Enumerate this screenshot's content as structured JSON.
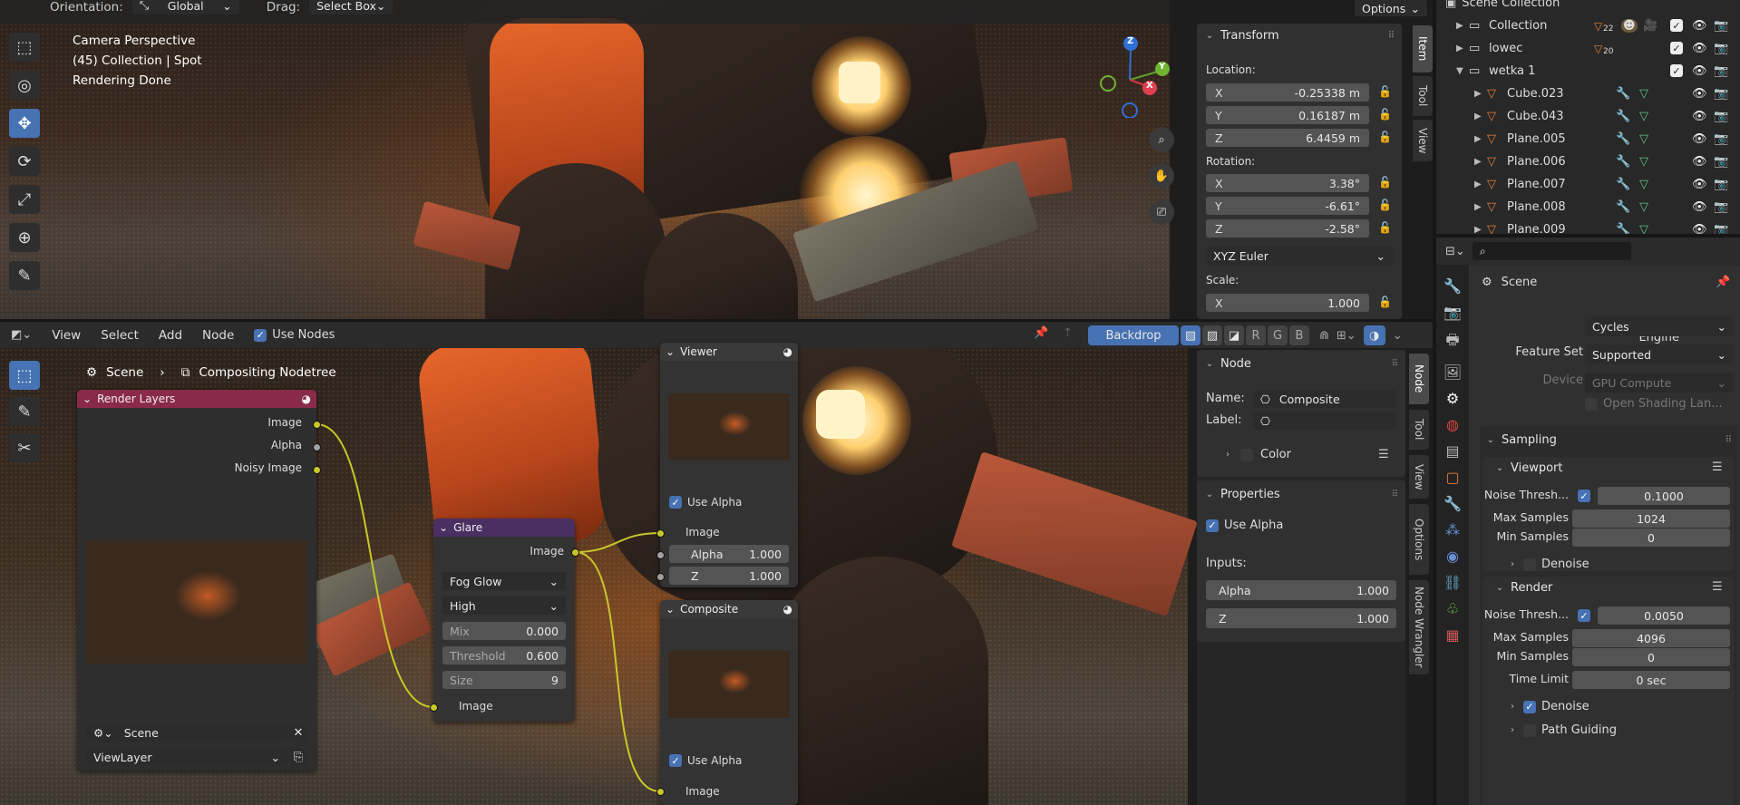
{
  "top_header": {
    "orientation_label": "Orientation:",
    "orientation_value": "Global",
    "drag_label": "Drag:",
    "drag_value": "Select Box",
    "options_label": "Options"
  },
  "viewport": {
    "overlay_line1": "Camera Perspective",
    "overlay_line2": "(45) Collection | Spot",
    "overlay_line3": "Rendering Done",
    "gizmo": {
      "z": "Z",
      "y": "Y",
      "x": "X"
    }
  },
  "n_panel": {
    "tabs": [
      "Item",
      "Tool",
      "View"
    ],
    "transform_title": "Transform",
    "location_label": "Location:",
    "location": [
      {
        "axis": "X",
        "value": "-0.25338 m"
      },
      {
        "axis": "Y",
        "value": "0.16187 m"
      },
      {
        "axis": "Z",
        "value": "6.4459 m"
      }
    ],
    "rotation_label": "Rotation:",
    "rotation": [
      {
        "axis": "X",
        "value": "3.38°"
      },
      {
        "axis": "Y",
        "value": "-6.61°"
      },
      {
        "axis": "Z",
        "value": "-2.58°"
      }
    ],
    "rotation_mode": "XYZ Euler",
    "scale_label": "Scale:",
    "scale": [
      {
        "axis": "X",
        "value": "1.000"
      }
    ]
  },
  "outliner": {
    "root": "Scene Collection",
    "rows": [
      {
        "name": "Collection",
        "level": 1,
        "badge": "22"
      },
      {
        "name": "lowec",
        "level": 1,
        "badge": "20"
      },
      {
        "name": "wetka 1",
        "level": 1,
        "badge": ""
      },
      {
        "name": "Cube.023",
        "level": 2,
        "badge": ""
      },
      {
        "name": "Cube.043",
        "level": 2,
        "badge": ""
      },
      {
        "name": "Plane.005",
        "level": 2,
        "badge": ""
      },
      {
        "name": "Plane.006",
        "level": 2,
        "badge": ""
      },
      {
        "name": "Plane.007",
        "level": 2,
        "badge": ""
      },
      {
        "name": "Plane.008",
        "level": 2,
        "badge": ""
      },
      {
        "name": "Plane.009",
        "level": 2,
        "badge": ""
      }
    ]
  },
  "node_header": {
    "menus": [
      "View",
      "Select",
      "Add",
      "Node"
    ],
    "use_nodes": "Use Nodes",
    "backdrop": "Backdrop",
    "channels": [
      "R",
      "G",
      "B"
    ]
  },
  "node_editor": {
    "breadcrumb_scene": "Scene",
    "breadcrumb_tree": "Compositing Nodetree",
    "render_layers": {
      "title": "Render Layers",
      "outputs": [
        "Image",
        "Alpha",
        "Noisy Image"
      ],
      "scene": "Scene",
      "view_layer": "ViewLayer"
    },
    "glare": {
      "title": "Glare",
      "output": "Image",
      "type": "Fog Glow",
      "quality": "High",
      "mix_label": "Mix",
      "mix_value": "0.000",
      "threshold_label": "Threshold",
      "threshold_value": "0.600",
      "size_label": "Size",
      "size_value": "9",
      "input": "Image"
    },
    "viewer": {
      "title": "Viewer",
      "use_alpha": "Use Alpha",
      "image": "Image",
      "alpha_label": "Alpha",
      "alpha_value": "1.000",
      "z_label": "Z",
      "z_value": "1.000"
    },
    "composite": {
      "title": "Composite",
      "use_alpha": "Use Alpha",
      "image": "Image"
    }
  },
  "node_sidebar": {
    "tabs": [
      "Node",
      "Tool",
      "View",
      "Options",
      "Node Wrangler"
    ],
    "node_title": "Node",
    "name_label": "Name:",
    "name_value": "Composite",
    "label_label": "Label:",
    "label_value": "",
    "color_label": "Color",
    "properties_title": "Properties",
    "use_alpha": "Use Alpha",
    "inputs_label": "Inputs:",
    "alpha_label": "Alpha",
    "alpha_value": "1.000",
    "z_label": "Z",
    "z_value": "1.000"
  },
  "properties": {
    "scene_title": "Scene",
    "render_engine_label": "Render Engine",
    "render_engine": "Cycles",
    "feature_set_label": "Feature Set",
    "feature_set": "Supported",
    "device_label": "Device",
    "device": "GPU Compute",
    "osl_label": "Open Shading Lan...",
    "sampling_title": "Sampling",
    "viewport_title": "Viewport",
    "vp_noise_label": "Noise Thresh...",
    "vp_noise_value": "0.1000",
    "vp_max_label": "Max Samples",
    "vp_max_value": "1024",
    "vp_min_label": "Min Samples",
    "vp_min_value": "0",
    "vp_denoise": "Denoise",
    "render_title": "Render",
    "r_noise_label": "Noise Thresh...",
    "r_noise_value": "0.0050",
    "r_max_label": "Max Samples",
    "r_max_value": "4096",
    "r_min_label": "Min Samples",
    "r_min_value": "0",
    "r_time_label": "Time Limit",
    "r_time_value": "0 sec",
    "r_denoise": "Denoise",
    "path_guiding": "Path Guiding"
  },
  "colors": {
    "accent": "#4772b3",
    "render_layers_header": "#8a2a4a",
    "glare_header": "#4a2f63",
    "output_header": "#3a3a3a",
    "socket_yellow": "#c7c729",
    "socket_gray": "#a1a1a1"
  }
}
